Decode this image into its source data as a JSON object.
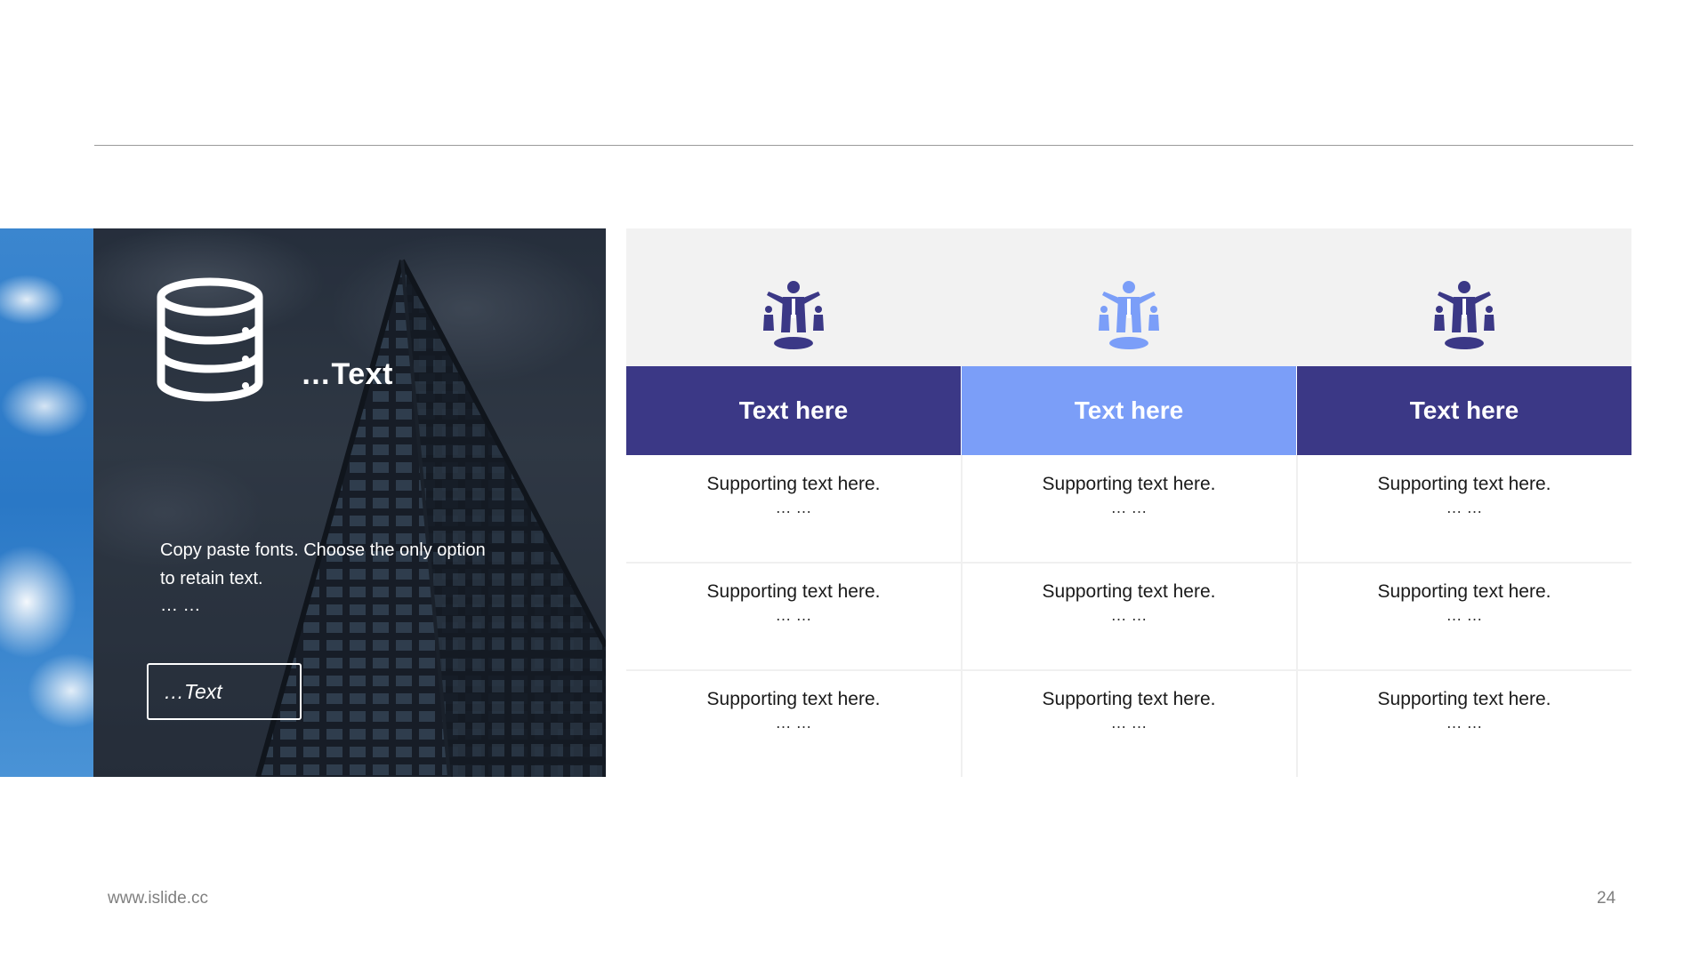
{
  "panel": {
    "title": "…Text",
    "body": "Copy paste fonts. Choose the only option to retain text.",
    "dots": "… …",
    "button_label": "…Text",
    "icon": "database-icon"
  },
  "table": {
    "icon": "leader-with-team-icon",
    "columns": [
      {
        "header": "Text here",
        "color": "#3b3886",
        "icon_color": "#3b3886",
        "cells": [
          {
            "text": "Supporting text here.",
            "dots": "… …"
          },
          {
            "text": "Supporting text here.",
            "dots": "… …"
          },
          {
            "text": "Supporting text here.",
            "dots": "… …"
          }
        ]
      },
      {
        "header": "Text here",
        "color": "#7b9ef8",
        "icon_color": "#7b9ef8",
        "cells": [
          {
            "text": "Supporting text here.",
            "dots": "… …"
          },
          {
            "text": "Supporting text here.",
            "dots": "… …"
          },
          {
            "text": "Supporting text here.",
            "dots": "… …"
          }
        ]
      },
      {
        "header": "Text here",
        "color": "#3b3886",
        "icon_color": "#3b3886",
        "cells": [
          {
            "text": "Supporting text here.",
            "dots": "… …"
          },
          {
            "text": "Supporting text here.",
            "dots": "… …"
          },
          {
            "text": "Supporting text here.",
            "dots": "… …"
          }
        ]
      }
    ]
  },
  "footer": {
    "url": "www.islide.cc",
    "page": "24"
  }
}
